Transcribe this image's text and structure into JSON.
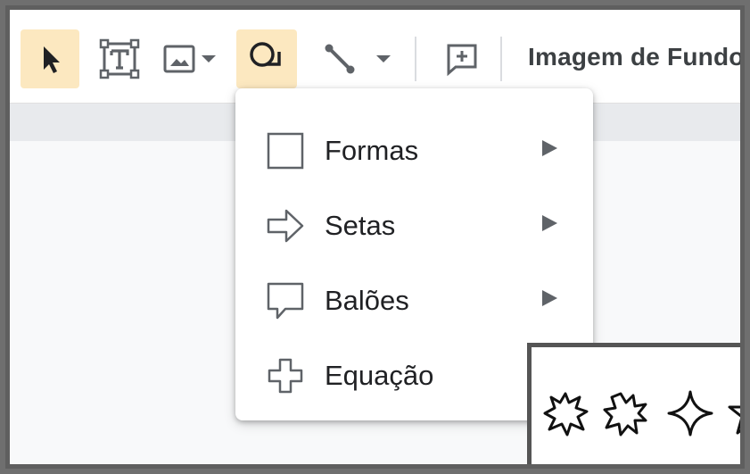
{
  "toolbar": {
    "background_label": "Imagem de Fundo",
    "tools": [
      {
        "name": "select-tool",
        "icon": "cursor-icon",
        "active": true
      },
      {
        "name": "text-box-tool",
        "icon": "text-box-icon",
        "active": false
      },
      {
        "name": "image-tool",
        "icon": "image-icon",
        "active": false
      },
      {
        "name": "shape-tool",
        "icon": "shape-icon",
        "active": true
      },
      {
        "name": "line-tool",
        "icon": "line-icon",
        "active": false
      },
      {
        "name": "comment-tool",
        "icon": "add-comment-icon",
        "active": false
      }
    ]
  },
  "shape_menu": {
    "items": [
      {
        "label": "Formas",
        "icon": "square-icon",
        "has_submenu": true
      },
      {
        "label": "Setas",
        "icon": "arrow-right-icon",
        "has_submenu": true
      },
      {
        "label": "Balões",
        "icon": "callout-icon",
        "has_submenu": true
      },
      {
        "label": "Equação",
        "icon": "plus-outline-icon",
        "has_submenu": false
      }
    ]
  },
  "colors": {
    "active_tool_bg": "#fce8c0",
    "icon_color": "#5f6368",
    "text_color": "#202124"
  }
}
